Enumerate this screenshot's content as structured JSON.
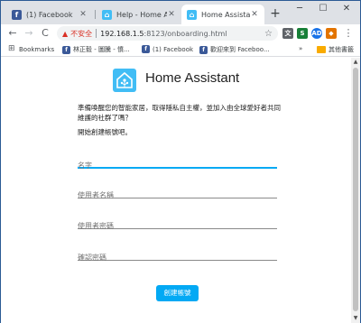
{
  "tabs": [
    {
      "title": "(1) Facebook",
      "icon": "facebook-icon",
      "active": false
    },
    {
      "title": "Help - Home Assist",
      "icon": "home-assistant-icon",
      "active": false
    },
    {
      "title": "Home Assistant",
      "icon": "home-assistant-icon",
      "active": true
    }
  ],
  "new_tab_symbol": "+",
  "window_controls": {
    "minimize": "─",
    "maximize": "☐",
    "close": "✕"
  },
  "toolbar": {
    "back": "←",
    "forward": "→",
    "reload": "C",
    "security_label": "不安全",
    "url_host": "192.168.1.5",
    "url_path": ":8123/onboarding.html",
    "star": "☆",
    "extensions": [
      {
        "label": "文",
        "color": "#5f6368"
      },
      {
        "label": "S",
        "color": "#188038"
      },
      {
        "label": "AD",
        "color": "#1a73e8"
      },
      {
        "label": "◆",
        "color": "#e37400"
      }
    ],
    "menu": "⋮"
  },
  "bookmarks": {
    "items": [
      {
        "label": "Bookmarks",
        "icon": "apps-icon"
      },
      {
        "label": "林正毅 - 圖騰 - 憤...",
        "icon": "facebook-icon"
      },
      {
        "label": "(1) Facebook",
        "icon": "facebook-icon"
      },
      {
        "label": "歡迎來到 Faceboo...",
        "icon": "facebook-icon"
      }
    ],
    "overflow": "»",
    "other_folder": "其他書籤"
  },
  "page": {
    "brand": "Home Assistant",
    "intro": "準備喚醒您的智能家居，取得隱私自主權，並加入由全球愛好者共同維護的社群了嗎？",
    "sub": "開始創建帳號吧。",
    "fields": {
      "name": {
        "placeholder": "名字"
      },
      "username": {
        "placeholder": "使用者名稱"
      },
      "password": {
        "placeholder": "使用者密碼"
      },
      "confirm": {
        "placeholder": "確認密碼"
      }
    },
    "submit": "創建帳號"
  },
  "colors": {
    "accent": "#03a9f4",
    "brand": "#41bdf5",
    "facebook": "#3b5998"
  }
}
